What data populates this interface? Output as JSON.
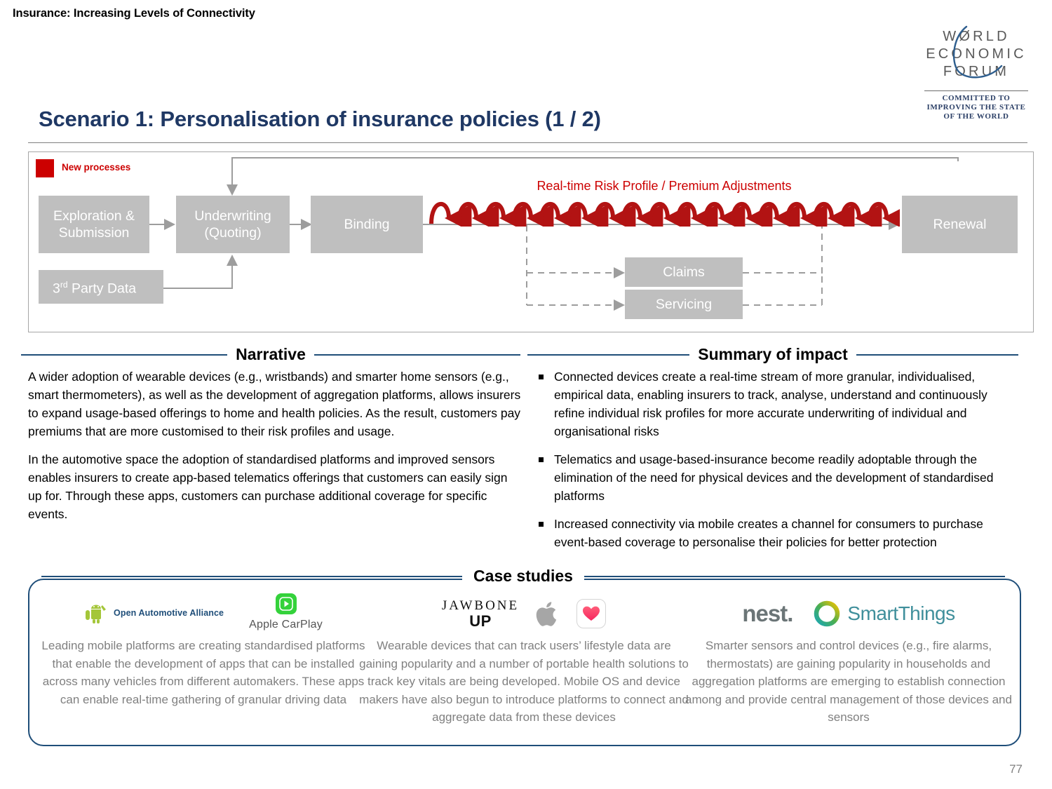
{
  "header": {
    "kicker": "Insurance: Increasing Levels of Connectivity",
    "logo": {
      "line1": "WØRLD",
      "line2": "ECONOMIC",
      "line3": "FORUM",
      "tagline1": "COMMITTED TO",
      "tagline2": "IMPROVING THE STATE",
      "tagline3": "OF THE WORLD"
    }
  },
  "slide": {
    "title": "Scenario 1: Personalisation of insurance policies (1 / 2)",
    "page_number": "77"
  },
  "diagram": {
    "legend_label": "New processes",
    "legend_color": "#CC0000",
    "node_color": "#BFBFBF",
    "nodes": {
      "exploration": "Exploration & Submission",
      "third_party": "3rd Party Data",
      "third_party_main": "3",
      "third_party_sup": "rd",
      "third_party_rest": " Party Data",
      "underwriting": "Underwriting (Quoting)",
      "underwriting_l1": "Underwriting",
      "underwriting_l2": "(Quoting)",
      "binding": "Binding",
      "renewal": "Renewal",
      "claims": "Claims",
      "servicing": "Servicing"
    },
    "realtime_label": "Real-time Risk Profile / Premium Adjustments",
    "loop_color": "#B21313",
    "loop_count": 17
  },
  "narrative": {
    "heading": "Narrative",
    "paragraphs": [
      "A wider adoption of wearable devices (e.g., wristbands) and smarter home sensors (e.g., smart thermometers), as well as the development of aggregation platforms, allows insurers to expand usage-based offerings to home and health policies. As the result, customers pay premiums that are more customised to their risk profiles and usage.",
      "In the automotive space the adoption of standardised platforms and improved sensors enables insurers to create app-based telematics offerings that customers can easily sign up for. Through these apps, customers can purchase additional coverage for specific events."
    ]
  },
  "impact": {
    "heading": "Summary of impact",
    "bullets": [
      "Connected devices create a real-time stream of more granular, individualised, empirical data, enabling insurers to track, analyse, understand and continuously refine individual risk profiles for more accurate underwriting of individual and organisational risks",
      "Telematics and usage-based-insurance become readily adoptable through the elimination of the need for physical devices and the development of standardised platforms",
      "Increased connectivity via mobile creates a channel for consumers to purchase event-based coverage to personalise their policies for better protection"
    ]
  },
  "case_studies": {
    "heading": "Case studies",
    "columns": [
      {
        "logos": [
          "android-icon",
          "open-automotive-alliance-wordmark",
          "apple-carplay-icon"
        ],
        "oaa_text": "Open Automotive Alliance",
        "carplay_text": "Apple CarPlay",
        "text": "Leading mobile platforms are creating standardised platforms that enable the development of apps that can be installed across many vehicles from different automakers. These apps can enable real-time gathering of granular driving data"
      },
      {
        "logos": [
          "jawbone-up-wordmark",
          "apple-logo-icon",
          "apple-health-icon"
        ],
        "jawbone_line1": "JAWBONE",
        "jawbone_line2": "UP",
        "text": "Wearable devices that can track users’ lifestyle data are gaining popularity and a number of portable health solutions to track key vitals are being developed. Mobile OS and device makers have also begun to introduce platforms to connect and aggregate data from these devices"
      },
      {
        "logos": [
          "nest-wordmark",
          "smartthings-ring-icon",
          "smartthings-wordmark"
        ],
        "nest_text": "nest.",
        "smartthings_text": "SmartThings",
        "text": "Smarter sensors and control devices (e.g., fire alarms, thermostats) are gaining popularity in households and aggregation platforms are emerging to establish connection among and provide central management of those devices and sensors"
      }
    ]
  }
}
